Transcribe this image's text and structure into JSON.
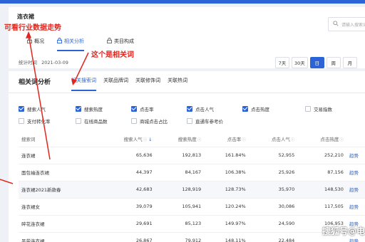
{
  "category_title": "连衣裙",
  "search": {
    "placeholder": "请输入搜索词"
  },
  "tabs": [
    {
      "label": "概况",
      "icon": "lock-icon"
    },
    {
      "label": "相关分析",
      "icon": "lock-icon"
    },
    {
      "label": "类目构成",
      "icon": "lock-icon"
    }
  ],
  "stat_time": {
    "label": "统计时间",
    "value": "2021-03-09"
  },
  "periods": [
    "7天",
    "30天",
    "日",
    "周",
    "月"
  ],
  "annotations": {
    "industry_trend": "可看行业数据走势",
    "related_words": "这个是相关词"
  },
  "panel": {
    "title": "相关词分析",
    "subtabs": [
      "相关搜索词",
      "关联品牌词",
      "关联修饰词",
      "关联热词"
    ]
  },
  "checkboxes": [
    {
      "label": "搜索人气",
      "checked": true
    },
    {
      "label": "搜索热度",
      "checked": true
    },
    {
      "label": "点击率",
      "checked": true
    },
    {
      "label": "点击人气",
      "checked": true
    },
    {
      "label": "点击热度",
      "checked": true
    },
    {
      "label": "交易指数",
      "checked": false
    },
    {
      "label": "支付转化率",
      "checked": false
    },
    {
      "label": "在线商品数",
      "checked": false
    },
    {
      "label": "商城点击占比",
      "checked": false
    },
    {
      "label": "直通车参考价",
      "checked": false
    }
  ],
  "table": {
    "headers": [
      "搜索词",
      "搜索人气",
      "搜索热度",
      "点击率",
      "点击人气",
      "点击热度"
    ],
    "action": "趋势",
    "rows": [
      [
        "连衣裙",
        "65,636",
        "192,813",
        "161.84%",
        "52,955",
        "252,210"
      ],
      [
        "面包袖连衣裙",
        "44,397",
        "84,167",
        "106.38%",
        "25,926",
        "87,156"
      ],
      [
        "连衣裙2021新款春",
        "42,683",
        "128,919",
        "128.73%",
        "35,970",
        "148,530"
      ],
      [
        "连衣裙女",
        "39,079",
        "105,941",
        "120.24%",
        "30,086",
        "117,505"
      ],
      [
        "碎花连衣裙",
        "29,691",
        "85,123",
        "149.97%",
        "24,590",
        "106,953"
      ],
      [
        "吊带连衣裙",
        "26,867",
        "79,912",
        "148.11%",
        "22,484",
        ""
      ]
    ]
  },
  "watermark": "搜狐号@电"
}
